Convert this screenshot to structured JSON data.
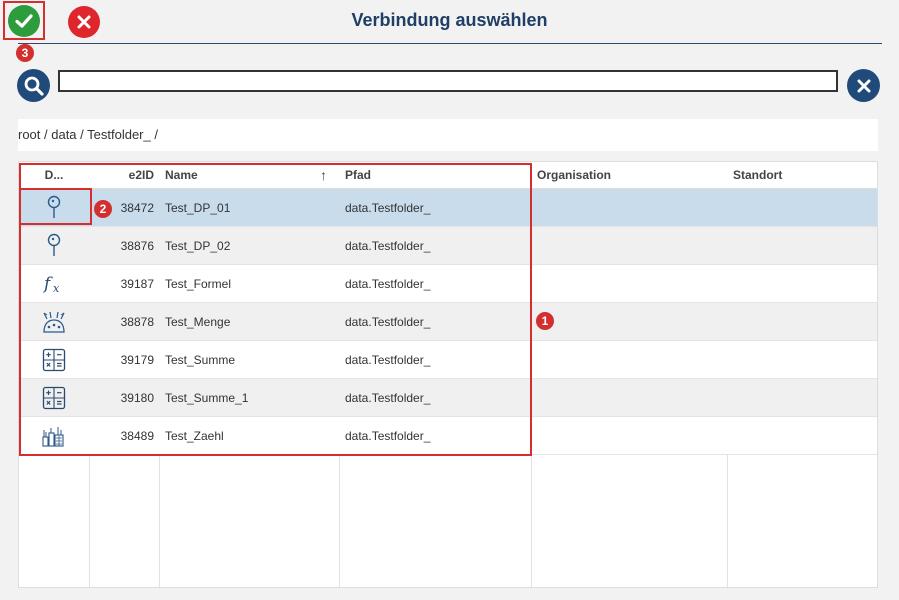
{
  "dialog": {
    "title": "Verbindung auswählen",
    "confirm_icon": "checkmark-icon",
    "cancel_icon": "close-icon"
  },
  "search": {
    "value": "",
    "placeholder": "",
    "search_icon": "search-icon",
    "clear_icon": "clear-icon"
  },
  "breadcrumb": "root / data / Testfolder_ /",
  "annotations": {
    "badge_1": "1",
    "badge_2": "2",
    "badge_3": "3"
  },
  "table": {
    "columns": [
      "D...",
      "e2ID",
      "Name",
      "Pfad",
      "Organisation",
      "Standort"
    ],
    "sort_indicator": "↑",
    "rows": [
      {
        "icon": "datapoint-pin-icon",
        "e2id": "38472",
        "name": "Test_DP_01",
        "pfad": "data.Testfolder_",
        "organisation": "",
        "standort": "",
        "selected": true
      },
      {
        "icon": "datapoint-pin-icon",
        "e2id": "38876",
        "name": "Test_DP_02",
        "pfad": "data.Testfolder_",
        "organisation": "",
        "standort": ""
      },
      {
        "icon": "formula-icon",
        "e2id": "39187",
        "name": "Test_Formel",
        "pfad": "data.Testfolder_",
        "organisation": "",
        "standort": ""
      },
      {
        "icon": "quantity-icon",
        "e2id": "38878",
        "name": "Test_Menge",
        "pfad": "data.Testfolder_",
        "organisation": "",
        "standort": ""
      },
      {
        "icon": "calculator-icon",
        "e2id": "39179",
        "name": "Test_Summe",
        "pfad": "data.Testfolder_",
        "organisation": "",
        "standort": ""
      },
      {
        "icon": "calculator-icon",
        "e2id": "39180",
        "name": "Test_Summe_1",
        "pfad": "data.Testfolder_",
        "organisation": "",
        "standort": ""
      },
      {
        "icon": "meter-counter-icon",
        "e2id": "38489",
        "name": "Test_Zaehl",
        "pfad": "data.Testfolder_",
        "organisation": "",
        "standort": ""
      }
    ]
  },
  "colors": {
    "accent": "#1f4a7a",
    "confirm": "#2c9c3c",
    "cancel": "#e0262d",
    "annotation": "#d32f2f",
    "selected_row": "#c9dcec"
  }
}
